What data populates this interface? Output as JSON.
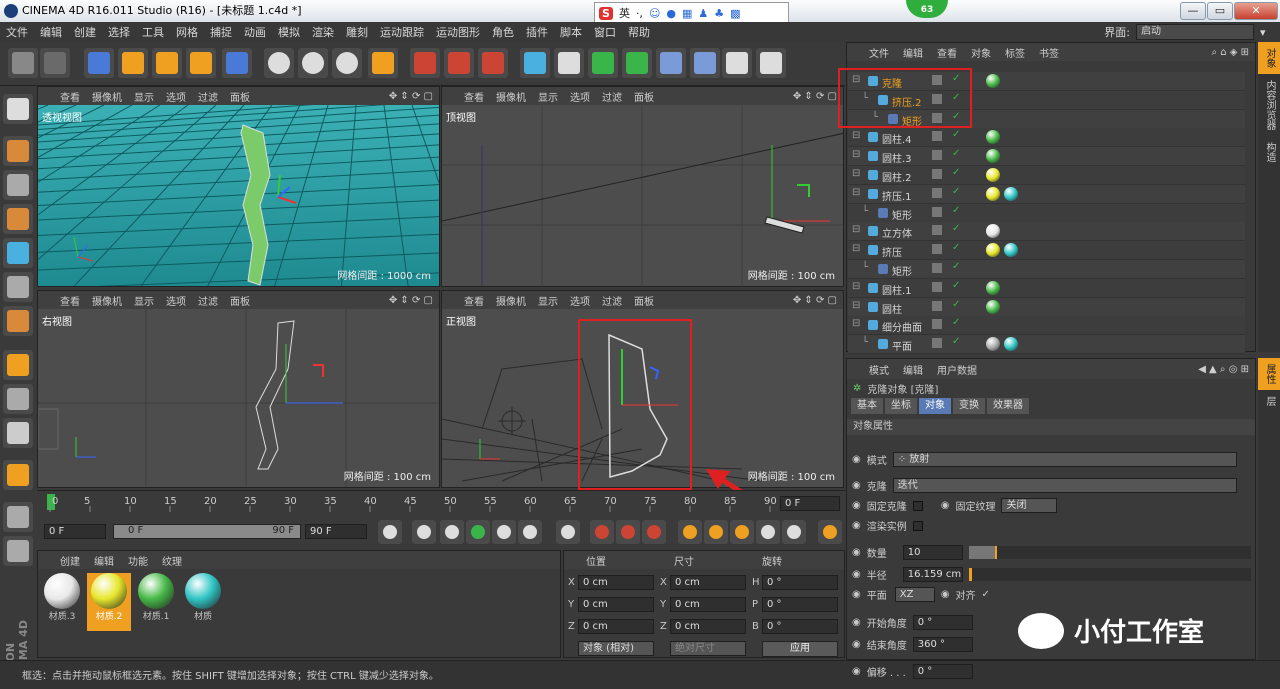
{
  "window": {
    "title": "CINEMA 4D R16.011 Studio (R16) - [未标题 1.c4d *]",
    "badge": "63",
    "ime": [
      "英",
      "·,"
    ],
    "controls": [
      "—",
      "▭",
      "✕"
    ]
  },
  "menu": [
    "文件",
    "编辑",
    "创建",
    "选择",
    "工具",
    "网格",
    "捕捉",
    "动画",
    "模拟",
    "渲染",
    "雕刻",
    "运动跟踪",
    "运动图形",
    "角色",
    "插件",
    "脚本",
    "窗口",
    "帮助"
  ],
  "layout": {
    "label": "界面:",
    "value": "启动"
  },
  "viewports": [
    {
      "name": "透视视图",
      "grid": "网格间距 : 1000 cm"
    },
    {
      "name": "顶视图",
      "grid": "网格间距 : 100 cm"
    },
    {
      "name": "右视图",
      "grid": "网格间距 : 100 cm"
    },
    {
      "name": "正视图",
      "grid": "网格间距 : 100 cm"
    }
  ],
  "vp_menu": [
    "查看",
    "摄像机",
    "显示",
    "选项",
    "过滤",
    "面板"
  ],
  "timeline": {
    "ticks": [
      "0",
      "5",
      "10",
      "15",
      "20",
      "25",
      "30",
      "35",
      "40",
      "45",
      "50",
      "55",
      "60",
      "65",
      "70",
      "75",
      "80",
      "85",
      "90"
    ],
    "frame_field": "0 F",
    "start": "0 F",
    "slider_start": "0 F",
    "slider_end": "90 F",
    "end": "90 F"
  },
  "materials": {
    "menu": [
      "创建",
      "编辑",
      "功能",
      "纹理"
    ],
    "items": [
      {
        "name": "材质.3",
        "color": "#e8e8e8"
      },
      {
        "name": "材质.2",
        "color": "#e6e62a"
      },
      {
        "name": "材质.1",
        "color": "#46b846"
      },
      {
        "name": "材质",
        "color": "#2fc4c4"
      }
    ]
  },
  "coords": {
    "headers": [
      "位置",
      "尺寸",
      "旋转"
    ],
    "rows": [
      [
        "X",
        "0 cm",
        "X",
        "0 cm",
        "H",
        "0 °"
      ],
      [
        "Y",
        "0 cm",
        "Y",
        "0 cm",
        "P",
        "0 °"
      ],
      [
        "Z",
        "0 cm",
        "Z",
        "0 cm",
        "B",
        "0 °"
      ]
    ],
    "mode": "对象 (相对)",
    "size_mode": "绝对尺寸",
    "apply": "应用"
  },
  "status": "框选：点击并拖动鼠标框选元素。按住 SHIFT 键增加选择对象；按住 CTRL 键减少选择对象。",
  "objects": {
    "menu": [
      "文件",
      "编辑",
      "查看",
      "对象",
      "标签",
      "书签"
    ],
    "items": [
      {
        "name": "克隆",
        "indent": 0,
        "color": "#f0a020",
        "tags": [
          "green"
        ]
      },
      {
        "name": "挤压.2",
        "indent": 1,
        "color": "#f0a020",
        "tags": []
      },
      {
        "name": "矩形",
        "indent": 2,
        "color": "#f0a020",
        "tags": []
      },
      {
        "name": "圆柱.4",
        "indent": 0,
        "color": "#d6d6d6",
        "tags": [
          "green"
        ]
      },
      {
        "name": "圆柱.3",
        "indent": 0,
        "color": "#d6d6d6",
        "tags": [
          "green"
        ]
      },
      {
        "name": "圆柱.2",
        "indent": 0,
        "color": "#d6d6d6",
        "tags": [
          "yellow"
        ]
      },
      {
        "name": "挤压.1",
        "indent": 0,
        "color": "#d6d6d6",
        "tags": [
          "yellow",
          "cyan"
        ]
      },
      {
        "name": "矩形",
        "indent": 1,
        "color": "#d6d6d6",
        "tags": []
      },
      {
        "name": "立方体",
        "indent": 0,
        "color": "#d6d6d6",
        "tags": [
          "white"
        ]
      },
      {
        "name": "挤压",
        "indent": 0,
        "color": "#d6d6d6",
        "tags": [
          "yellow",
          "cyan"
        ]
      },
      {
        "name": "矩形",
        "indent": 1,
        "color": "#d6d6d6",
        "tags": []
      },
      {
        "name": "圆柱.1",
        "indent": 0,
        "color": "#d6d6d6",
        "tags": [
          "green"
        ]
      },
      {
        "name": "圆柱",
        "indent": 0,
        "color": "#d6d6d6",
        "tags": [
          "green"
        ]
      },
      {
        "name": "细分曲面",
        "indent": 0,
        "color": "#d6d6d6",
        "tags": []
      },
      {
        "name": "平面",
        "indent": 1,
        "color": "#d6d6d6",
        "tags": [
          "checker",
          "cyan"
        ]
      }
    ]
  },
  "side_tabs": [
    "对象",
    "内容浏览器",
    "构造"
  ],
  "attr_side_tabs": [
    "属性",
    "层"
  ],
  "attributes": {
    "menu": [
      "模式",
      "编辑",
      "用户数据"
    ],
    "title": "克隆对象 [克隆]",
    "tabs": [
      "基本",
      "坐标",
      "对象",
      "变换",
      "效果器"
    ],
    "active_tab": "对象",
    "section": "对象属性",
    "mode_label": "模式",
    "mode_value": "放射",
    "clone_label": "克隆",
    "clone_value": "迭代",
    "fix_clone": "固定克隆",
    "fix_texture": "固定纹理",
    "fix_texture_value": "关闭",
    "render_instance": "渲染实例",
    "count_label": "数量",
    "count_value": "10",
    "radius_label": "半径",
    "radius_value": "16.159 cm",
    "plane_label": "平面",
    "plane_value": "XZ",
    "align_label": "对齐",
    "start_label": "开始角度",
    "start_value": "0 °",
    "end_label": "结束角度",
    "end_value": "360 °",
    "offset_label": "偏移 . . .",
    "offset_value": "0 °"
  },
  "watermark": "小付工作室"
}
